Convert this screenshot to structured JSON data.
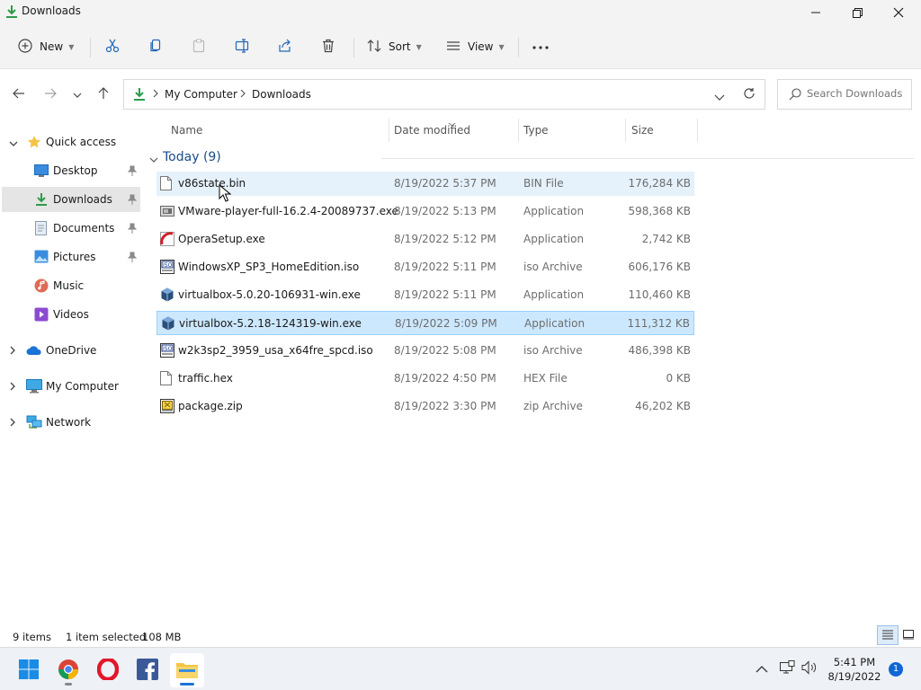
{
  "window": {
    "title": "Downloads"
  },
  "toolbar": {
    "new_label": "New",
    "sort_label": "Sort",
    "view_label": "View"
  },
  "address": {
    "crumbs": [
      "My Computer",
      "Downloads"
    ],
    "search_placeholder": "Search Downloads"
  },
  "sidebar": {
    "quick_access": "Quick access",
    "items": [
      {
        "label": "Desktop",
        "icon": "desktop-icon"
      },
      {
        "label": "Downloads",
        "icon": "download-icon"
      },
      {
        "label": "Documents",
        "icon": "document-icon"
      },
      {
        "label": "Pictures",
        "icon": "picture-icon"
      },
      {
        "label": "Music",
        "icon": "music-icon"
      },
      {
        "label": "Videos",
        "icon": "video-icon"
      }
    ],
    "onedrive": "OneDrive",
    "my_computer": "My Computer",
    "network": "Network"
  },
  "columns": {
    "name": "Name",
    "date": "Date modified",
    "type": "Type",
    "size": "Size"
  },
  "group": {
    "label": "Today (9)"
  },
  "files": [
    {
      "name": "v86state.bin",
      "date": "8/19/2022 5:37 PM",
      "type": "BIN File",
      "size": "176,284 KB",
      "icon": "blank-file-icon"
    },
    {
      "name": "VMware-player-full-16.2.4-20089737.exe",
      "date": "8/19/2022 5:13 PM",
      "type": "Application",
      "size": "598,368 KB",
      "icon": "vmware-icon"
    },
    {
      "name": "OperaSetup.exe",
      "date": "8/19/2022 5:12 PM",
      "type": "Application",
      "size": "2,742 KB",
      "icon": "opera-setup-icon"
    },
    {
      "name": "WindowsXP_SP3_HomeEdition.iso",
      "date": "8/19/2022 5:11 PM",
      "type": "iso Archive",
      "size": "606,176 KB",
      "icon": "iso-archive-icon"
    },
    {
      "name": "virtualbox-5.0.20-106931-win.exe",
      "date": "8/19/2022 5:11 PM",
      "type": "Application",
      "size": "110,460 KB",
      "icon": "virtualbox-icon"
    },
    {
      "name": "virtualbox-5.2.18-124319-win.exe",
      "date": "8/19/2022 5:09 PM",
      "type": "Application",
      "size": "111,312 KB",
      "icon": "virtualbox-icon"
    },
    {
      "name": "w2k3sp2_3959_usa_x64fre_spcd.iso",
      "date": "8/19/2022 5:08 PM",
      "type": "iso Archive",
      "size": "486,398 KB",
      "icon": "iso-archive-icon"
    },
    {
      "name": "traffic.hex",
      "date": "8/19/2022 4:50 PM",
      "type": "HEX File",
      "size": "0 KB",
      "icon": "blank-file-icon"
    },
    {
      "name": "package.zip",
      "date": "8/19/2022 3:30 PM",
      "type": "zip Archive",
      "size": "46,202 KB",
      "icon": "zip-archive-icon"
    }
  ],
  "status": {
    "count": "9 items",
    "selection": "1 item selected",
    "selection_size": "108 MB"
  },
  "taskbar": {
    "time": "5:41 PM",
    "date": "8/19/2022",
    "notifications": "1"
  },
  "colors": {
    "accent": "#0078d4",
    "selection_bg": "#cce8ff",
    "hover_bg": "#e5f1fb",
    "folder_yellow": "#f3c443"
  }
}
